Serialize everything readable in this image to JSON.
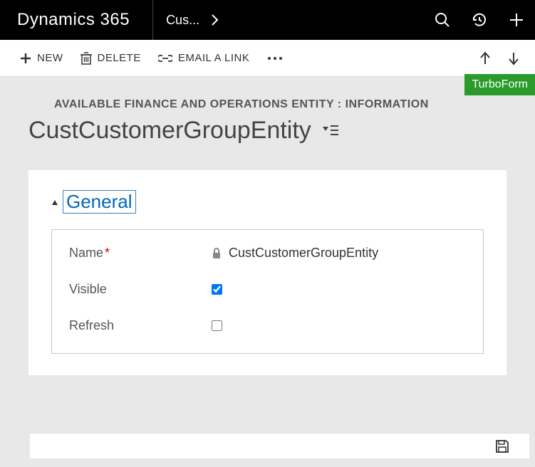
{
  "topbar": {
    "brand": "Dynamics 365",
    "nav_item": "Cus..."
  },
  "commands": {
    "new": "NEW",
    "delete": "DELETE",
    "email": "EMAIL A LINK"
  },
  "overline": "AVAILABLE FINANCE AND OPERATIONS ENTITY : INFORMATION",
  "title": "CustCustomerGroupEntity",
  "badge": "TurboForm",
  "section": {
    "title": "General"
  },
  "fields": {
    "name_label": "Name",
    "name_value": "CustCustomerGroupEntity",
    "visible_label": "Visible",
    "visible_checked": true,
    "refresh_label": "Refresh",
    "refresh_checked": false
  }
}
